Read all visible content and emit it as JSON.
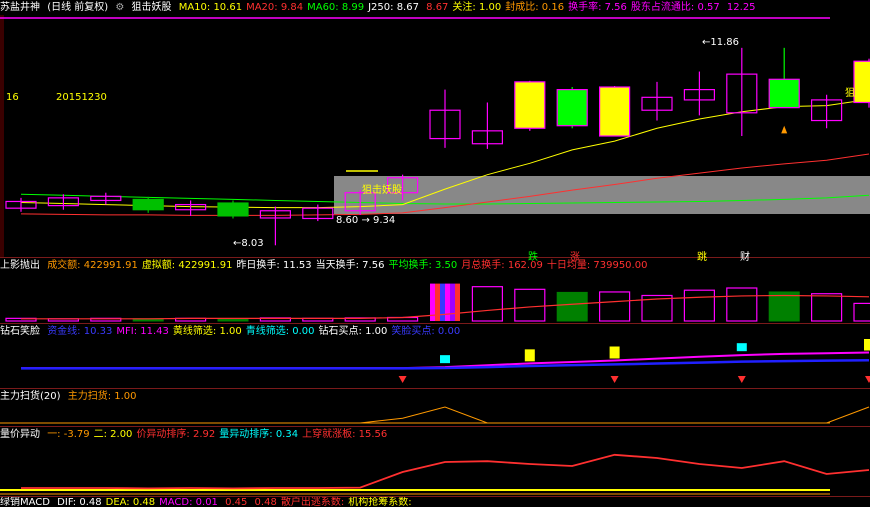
{
  "main_header": {
    "title": "苏盐井神",
    "period": "(日线 前复权)",
    "indicator_name": "狙击妖股",
    "items": [
      {
        "label": "MA10:",
        "value": "10.61",
        "color": "#ffff00"
      },
      {
        "label": "MA20:",
        "value": "9.84",
        "color": "#ff3030"
      },
      {
        "label": "MA60:",
        "value": "8.99",
        "color": "#00ff00"
      },
      {
        "label": "J250:",
        "value": "8.67",
        "color": "#ffffff"
      },
      {
        "label": "",
        "value": "8.67",
        "color": "#ff3030"
      },
      {
        "label": "关注:",
        "value": "1.00",
        "color": "#ffff00"
      },
      {
        "label": "封成比:",
        "value": "0.16",
        "color": "#ff9900"
      },
      {
        "label": "换手率:",
        "value": "7.56",
        "color": "#ff00ff"
      },
      {
        "label": "股东占流通比:",
        "value": "0.57",
        "color": "#ff00ff"
      },
      {
        "label": "",
        "value": "12.25",
        "color": "#ff00ff"
      }
    ]
  },
  "main_labels": {
    "left_num": "16",
    "date": "20151230",
    "zone": "狙击妖股",
    "high": "11.86",
    "low": "8.03",
    "mid_a": "8.60",
    "mid_b": "9.34",
    "right_tag": "狙妖股"
  },
  "markers": [
    "跌",
    "涨",
    "跳",
    "财"
  ],
  "vol_header": {
    "name": "上影抛出",
    "items": [
      {
        "label": "成交额:",
        "value": "422991.91",
        "color": "#ff9900"
      },
      {
        "label": "虚拟额:",
        "value": "422991.91",
        "color": "#ffff00"
      },
      {
        "label": "昨日换手:",
        "value": "11.53",
        "color": "#ffffff"
      },
      {
        "label": "当天换手:",
        "value": "7.56",
        "color": "#ffffff"
      },
      {
        "label": "平均换手:",
        "value": "3.50",
        "color": "#00ff00"
      },
      {
        "label": "月总换手:",
        "value": "162.09",
        "color": "#ff3030"
      },
      {
        "label": "十日均量:",
        "value": "739950.00",
        "color": "#ff3030"
      }
    ]
  },
  "diamond_header": {
    "name": "钻石笑脸",
    "items": [
      {
        "label": "资金线:",
        "value": "10.33",
        "color": "#3a3aff"
      },
      {
        "label": "MFI:",
        "value": "11.43",
        "color": "#ff00ff"
      },
      {
        "label": "黄线筛选:",
        "value": "1.00",
        "color": "#ffff00"
      },
      {
        "label": "青线筛选:",
        "value": "0.00",
        "color": "#00ffff"
      },
      {
        "label": "钻石买点:",
        "value": "1.00",
        "color": "#ffffff"
      },
      {
        "label": "笑脸买点:",
        "value": "0.00",
        "color": "#3a3aff"
      }
    ]
  },
  "capital_header": {
    "name": "主力扫货(20)",
    "items": [
      {
        "label": "主力扫货:",
        "value": "1.00",
        "color": "#ff9900"
      }
    ]
  },
  "vp_header": {
    "name": "量价异动",
    "items": [
      {
        "label": "一:",
        "value": "-3.79",
        "color": "#ff9900"
      },
      {
        "label": "二:",
        "value": "2.00",
        "color": "#ffff00"
      },
      {
        "label": "价异动排序:",
        "value": "2.92",
        "color": "#ff3030"
      },
      {
        "label": "量异动排序:",
        "value": "0.34",
        "color": "#00ffff"
      },
      {
        "label": "上穿就涨板:",
        "value": "15.56",
        "color": "#ff3030"
      }
    ]
  },
  "macd_header": {
    "name": "绿销MACD",
    "items": [
      {
        "label": "DIF:",
        "value": "0.48",
        "color": "#ffffff"
      },
      {
        "label": "DEA:",
        "value": "0.48",
        "color": "#ffff00"
      },
      {
        "label": "MACD:",
        "value": "0.01",
        "color": "#ff00ff"
      },
      {
        "label": "",
        "value": "0.45",
        "color": "#ff3030"
      },
      {
        "label": "",
        "value": "0.48",
        "color": "#ff3030"
      },
      {
        "label": "散户出逃系数:",
        "value": "",
        "color": "#ff3030"
      },
      {
        "label": "机构抢筹系数:",
        "value": "",
        "color": "#ffff00"
      }
    ]
  },
  "colors": {
    "up": "#ff00ff",
    "down": "#00c000",
    "fill_up": "#ffff00",
    "fill_down": "#00ff00",
    "ma10": "#ffff00",
    "ma20": "#ff3030",
    "ma60": "#00ff00",
    "zone": "#a0a0a0"
  },
  "chart_data": {
    "type": "candlestick",
    "candles": [
      {
        "o": 8.75,
        "c": 8.88,
        "h": 8.95,
        "l": 8.68,
        "style": "hollow-up"
      },
      {
        "o": 8.95,
        "c": 8.8,
        "h": 9.02,
        "l": 8.72,
        "style": "hollow-up"
      },
      {
        "o": 8.9,
        "c": 8.98,
        "h": 9.05,
        "l": 8.82,
        "style": "hollow-up"
      },
      {
        "o": 8.72,
        "c": 8.92,
        "h": 8.97,
        "l": 8.66,
        "style": "solid-down"
      },
      {
        "o": 8.72,
        "c": 8.82,
        "h": 8.9,
        "l": 8.6,
        "style": "hollow-up"
      },
      {
        "o": 8.6,
        "c": 8.85,
        "h": 8.9,
        "l": 8.55,
        "style": "solid-down"
      },
      {
        "o": 8.56,
        "c": 8.7,
        "h": 8.78,
        "l": 8.03,
        "style": "hollow-up"
      },
      {
        "o": 8.55,
        "c": 8.75,
        "h": 8.82,
        "l": 8.5,
        "style": "hollow-up"
      },
      {
        "o": 8.7,
        "c": 9.05,
        "h": 9.1,
        "l": 8.62,
        "style": "hollow-up"
      },
      {
        "o": 9.05,
        "c": 9.34,
        "h": 9.4,
        "l": 8.9,
        "style": "hollow-up"
      },
      {
        "o": 10.1,
        "c": 10.65,
        "h": 11.05,
        "l": 9.92,
        "style": "hollow-up"
      },
      {
        "o": 10.0,
        "c": 10.25,
        "h": 10.8,
        "l": 9.9,
        "style": "hollow-up"
      },
      {
        "o": 10.3,
        "c": 11.2,
        "h": 11.22,
        "l": 10.25,
        "style": "solid-up"
      },
      {
        "o": 10.35,
        "c": 11.05,
        "h": 11.1,
        "l": 10.3,
        "style": "solid-green"
      },
      {
        "o": 10.15,
        "c": 11.1,
        "h": 11.12,
        "l": 10.15,
        "style": "solid-up"
      },
      {
        "o": 10.65,
        "c": 10.9,
        "h": 11.2,
        "l": 10.45,
        "style": "hollow-up"
      },
      {
        "o": 10.85,
        "c": 11.05,
        "h": 11.4,
        "l": 10.55,
        "style": "hollow-up"
      },
      {
        "o": 10.6,
        "c": 11.35,
        "h": 11.86,
        "l": 10.15,
        "style": "hollow-up"
      },
      {
        "o": 10.7,
        "c": 11.25,
        "h": 11.86,
        "l": 10.7,
        "style": "solid-green"
      },
      {
        "o": 10.45,
        "c": 10.85,
        "h": 10.95,
        "l": 10.3,
        "style": "hollow-up"
      },
      {
        "o": 10.8,
        "c": 11.6,
        "h": 11.65,
        "l": 10.7,
        "style": "solid-up"
      }
    ],
    "ma10": [
      8.86,
      8.84,
      8.82,
      8.8,
      8.78,
      8.77,
      8.76,
      8.76,
      8.78,
      8.82,
      9.12,
      9.4,
      9.62,
      9.88,
      10.05,
      10.3,
      10.48,
      10.62,
      10.72,
      10.74,
      10.86
    ],
    "ma20": [
      8.64,
      8.63,
      8.62,
      8.62,
      8.61,
      8.61,
      8.61,
      8.62,
      8.63,
      8.66,
      8.76,
      8.87,
      8.98,
      9.1,
      9.21,
      9.33,
      9.43,
      9.53,
      9.61,
      9.68,
      9.8
    ],
    "ma60": [
      9.02,
      9.0,
      8.98,
      8.96,
      8.94,
      8.92,
      8.9,
      8.88,
      8.86,
      8.84,
      8.83,
      8.83,
      8.84,
      8.85,
      8.86,
      8.87,
      8.88,
      8.9,
      8.92,
      8.95,
      9.0
    ],
    "volume": [
      0.06,
      0.05,
      0.06,
      0.05,
      0.06,
      0.05,
      0.07,
      0.06,
      0.07,
      0.08,
      0.85,
      0.78,
      0.72,
      0.65,
      0.66,
      0.58,
      0.7,
      0.75,
      0.66,
      0.62,
      0.4
    ],
    "volume_style": [
      "up",
      "up",
      "up",
      "down",
      "up",
      "down",
      "up",
      "up",
      "up",
      "up",
      "multi",
      "up",
      "up",
      "down",
      "up",
      "up",
      "up",
      "up",
      "down",
      "up",
      "up"
    ],
    "vol_ma": [
      0.05,
      0.05,
      0.05,
      0.05,
      0.06,
      0.06,
      0.06,
      0.06,
      0.06,
      0.08,
      0.15,
      0.24,
      0.32,
      0.38,
      0.44,
      0.5,
      0.54,
      0.57,
      0.58,
      0.57,
      0.55
    ],
    "fund_line": [
      0.1,
      0.1,
      0.1,
      0.1,
      0.1,
      0.1,
      0.1,
      0.1,
      0.1,
      0.1,
      0.12,
      0.18,
      0.25,
      0.3,
      0.35,
      0.4,
      0.46,
      0.52,
      0.55,
      0.58,
      0.6
    ],
    "mfi_line": [
      0.1,
      0.1,
      0.1,
      0.1,
      0.1,
      0.1,
      0.1,
      0.1,
      0.1,
      0.1,
      0.15,
      0.25,
      0.35,
      0.42,
      0.5,
      0.6,
      0.7,
      0.78,
      0.85,
      0.88,
      0.92
    ],
    "sq_yellow": [
      12,
      14,
      20
    ],
    "sq_cyan": [
      10,
      17
    ],
    "diamond_idx": [
      9,
      14,
      17,
      20
    ],
    "capital": [
      0,
      0,
      0,
      0,
      0,
      0,
      0,
      0,
      0,
      0.3,
      1,
      0,
      0,
      0,
      0,
      0,
      0,
      0,
      0,
      0,
      1
    ],
    "vp_red": [
      0.05,
      0.05,
      0.05,
      0.04,
      0.05,
      0.04,
      0.05,
      0.05,
      0.06,
      0.45,
      0.7,
      0.72,
      0.65,
      0.6,
      0.88,
      0.8,
      0.65,
      0.55,
      0.72,
      0.4,
      0.5
    ],
    "vp_yellow": 0.05
  }
}
